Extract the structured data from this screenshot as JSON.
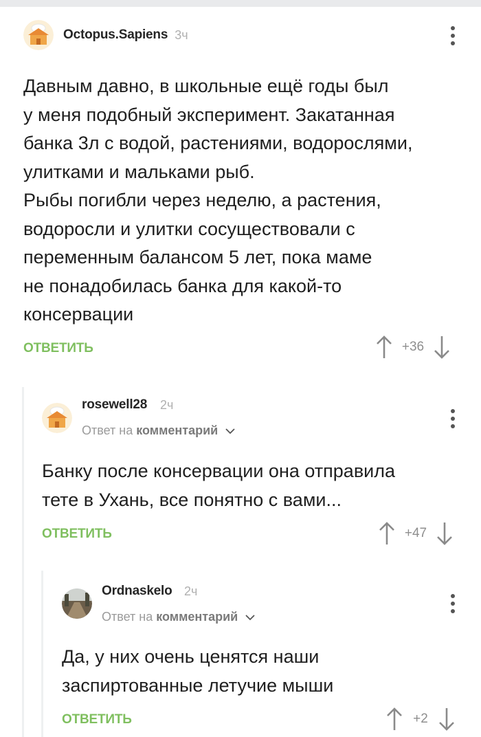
{
  "comments": [
    {
      "username": "Octopus.Sapiens",
      "time": "3ч",
      "text": "Давным давно, в школьные ещё годы был\nу меня подобный эксперимент. Закатанная\nбанка 3л с водой, растениями, водорослями,\nулитками и мальками рыб.\nРыбы погибли через неделю, а растения,\nводоросли и улитки сосуществовали с\nпеременным балансом 5 лет, пока маме\nне понадобилась банка для какой-то\nконсервации",
      "reply_label": "ОТВЕТИТЬ",
      "rating": "+36",
      "avatar_icon": "bakery-house-avatar"
    },
    {
      "username": "rosewell28",
      "time": "2ч",
      "reply_prefix": "Ответ на",
      "reply_target": "комментарий",
      "text": "Банку после консервации она отправила\nтете в Ухань, все понятно с вами...",
      "reply_label": "ОТВЕТИТЬ",
      "rating": "+47",
      "avatar_icon": "bakery-house-avatar"
    },
    {
      "username": "Ordnaskelo",
      "time": "2ч",
      "reply_prefix": "Ответ на",
      "reply_target": "комментарий",
      "text": "Да, у них очень ценятся наши\nзаспиртованные летучие мыши",
      "reply_label": "ОТВЕТИТЬ",
      "rating": "+2",
      "avatar_icon": "road-photo-avatar"
    }
  ],
  "colors": {
    "accent_green": "#7fbf5f",
    "thread_line": "#eef0f1",
    "muted": "#9a9a9a"
  }
}
